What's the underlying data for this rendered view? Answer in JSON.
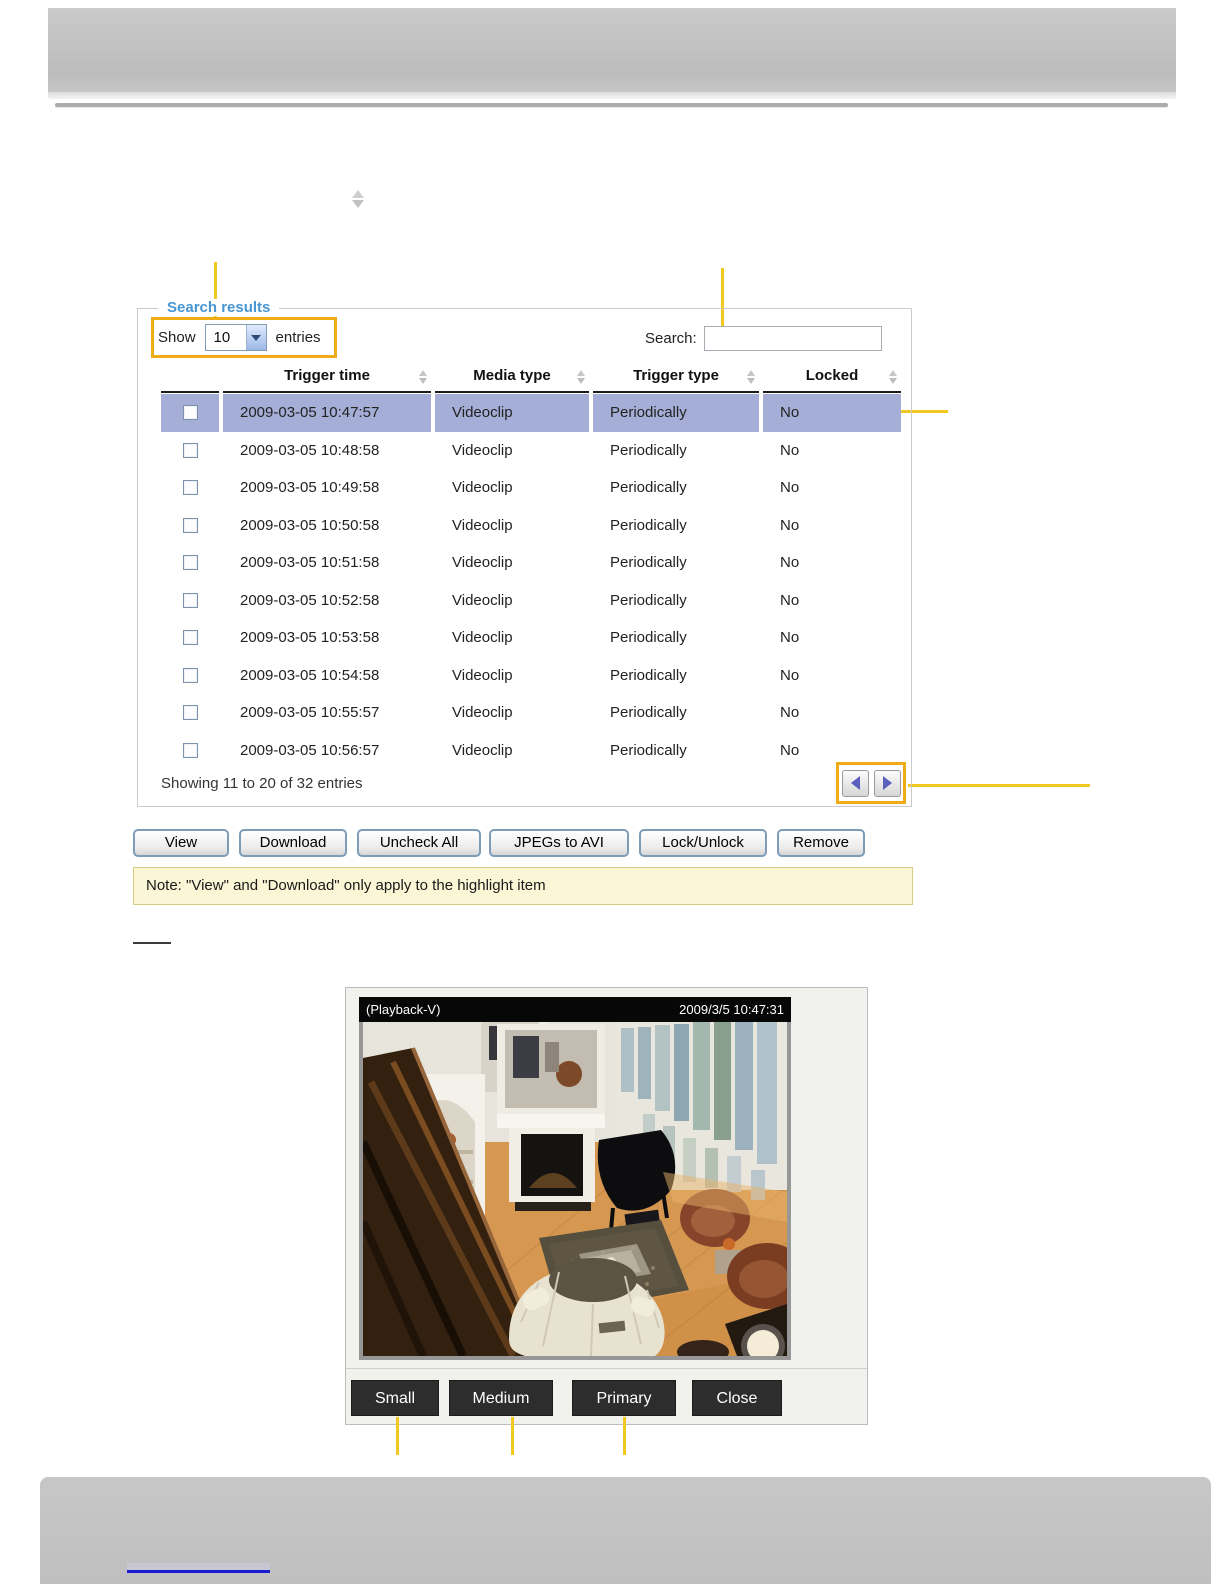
{
  "search_panel": {
    "legend": "Search results",
    "show_entries": {
      "show_label": "Show",
      "selected": "10",
      "entries_label": "entries"
    },
    "search": {
      "label": "Search:",
      "value": ""
    },
    "table": {
      "columns": [
        "Trigger time",
        "Media type",
        "Trigger type",
        "Locked"
      ],
      "highlighted_row_index": 0,
      "rows": [
        {
          "trigger_time": "2009-03-05 10:47:57",
          "media_type": "Videoclip",
          "trigger_type": "Periodically",
          "locked": "No"
        },
        {
          "trigger_time": "2009-03-05 10:48:58",
          "media_type": "Videoclip",
          "trigger_type": "Periodically",
          "locked": "No"
        },
        {
          "trigger_time": "2009-03-05 10:49:58",
          "media_type": "Videoclip",
          "trigger_type": "Periodically",
          "locked": "No"
        },
        {
          "trigger_time": "2009-03-05 10:50:58",
          "media_type": "Videoclip",
          "trigger_type": "Periodically",
          "locked": "No"
        },
        {
          "trigger_time": "2009-03-05 10:51:58",
          "media_type": "Videoclip",
          "trigger_type": "Periodically",
          "locked": "No"
        },
        {
          "trigger_time": "2009-03-05 10:52:58",
          "media_type": "Videoclip",
          "trigger_type": "Periodically",
          "locked": "No"
        },
        {
          "trigger_time": "2009-03-05 10:53:58",
          "media_type": "Videoclip",
          "trigger_type": "Periodically",
          "locked": "No"
        },
        {
          "trigger_time": "2009-03-05 10:54:58",
          "media_type": "Videoclip",
          "trigger_type": "Periodically",
          "locked": "No"
        },
        {
          "trigger_time": "2009-03-05 10:55:57",
          "media_type": "Videoclip",
          "trigger_type": "Periodically",
          "locked": "No"
        },
        {
          "trigger_time": "2009-03-05 10:56:57",
          "media_type": "Videoclip",
          "trigger_type": "Periodically",
          "locked": "No"
        }
      ]
    },
    "showing_text": "Showing 11 to 20 of 32 entries"
  },
  "action_buttons": [
    "View",
    "Download",
    "Uncheck All",
    "JPEGs to AVI",
    "Lock/Unlock",
    "Remove"
  ],
  "note_text": "Note: \"View\" and \"Download\" only apply to the highlight item",
  "playback": {
    "title": "(Playback-V)",
    "timestamp": "2009/3/5 10:47:31",
    "size_buttons": [
      "Small",
      "Medium",
      "Primary",
      "Close"
    ]
  },
  "colors": {
    "legend_blue": "#4796d3",
    "row_highlight": "#a4aed6",
    "callout_box_gold": "#efac17",
    "callout_line_gold": "#f2c71f",
    "note_bg": "#fbf6d5",
    "link_blue": "#1b1bd1"
  }
}
